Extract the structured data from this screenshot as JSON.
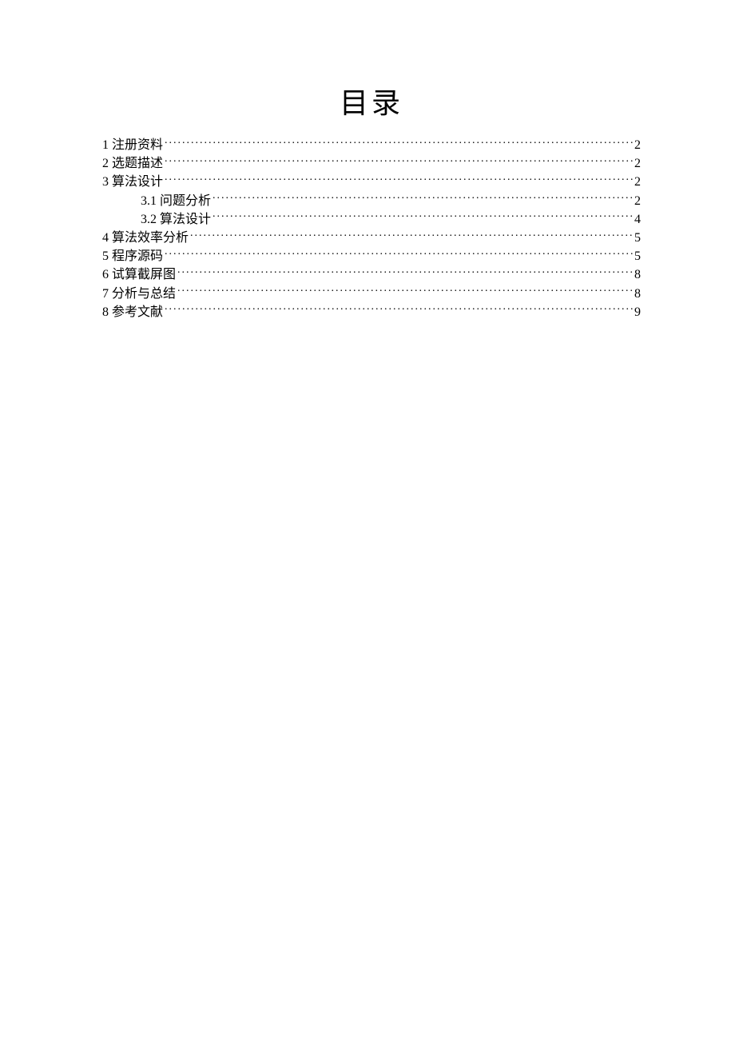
{
  "title": "目录",
  "entries": [
    {
      "level": 1,
      "label": "1 注册资料",
      "page": "2"
    },
    {
      "level": 1,
      "label": "2 选题描述",
      "page": "2"
    },
    {
      "level": 1,
      "label": "3 算法设计",
      "page": "2"
    },
    {
      "level": 2,
      "label": "3.1 问题分析",
      "page": "2"
    },
    {
      "level": 2,
      "label": "3.2 算法设计",
      "page": "4"
    },
    {
      "level": 1,
      "label": "4 算法效率分析",
      "page": "5"
    },
    {
      "level": 1,
      "label": "5 程序源码",
      "page": "5"
    },
    {
      "level": 1,
      "label": "6 试算截屏图",
      "page": "8"
    },
    {
      "level": 1,
      "label": "7 分析与总结",
      "page": "8"
    },
    {
      "level": 1,
      "label": "8 参考文献",
      "page": "9"
    }
  ]
}
